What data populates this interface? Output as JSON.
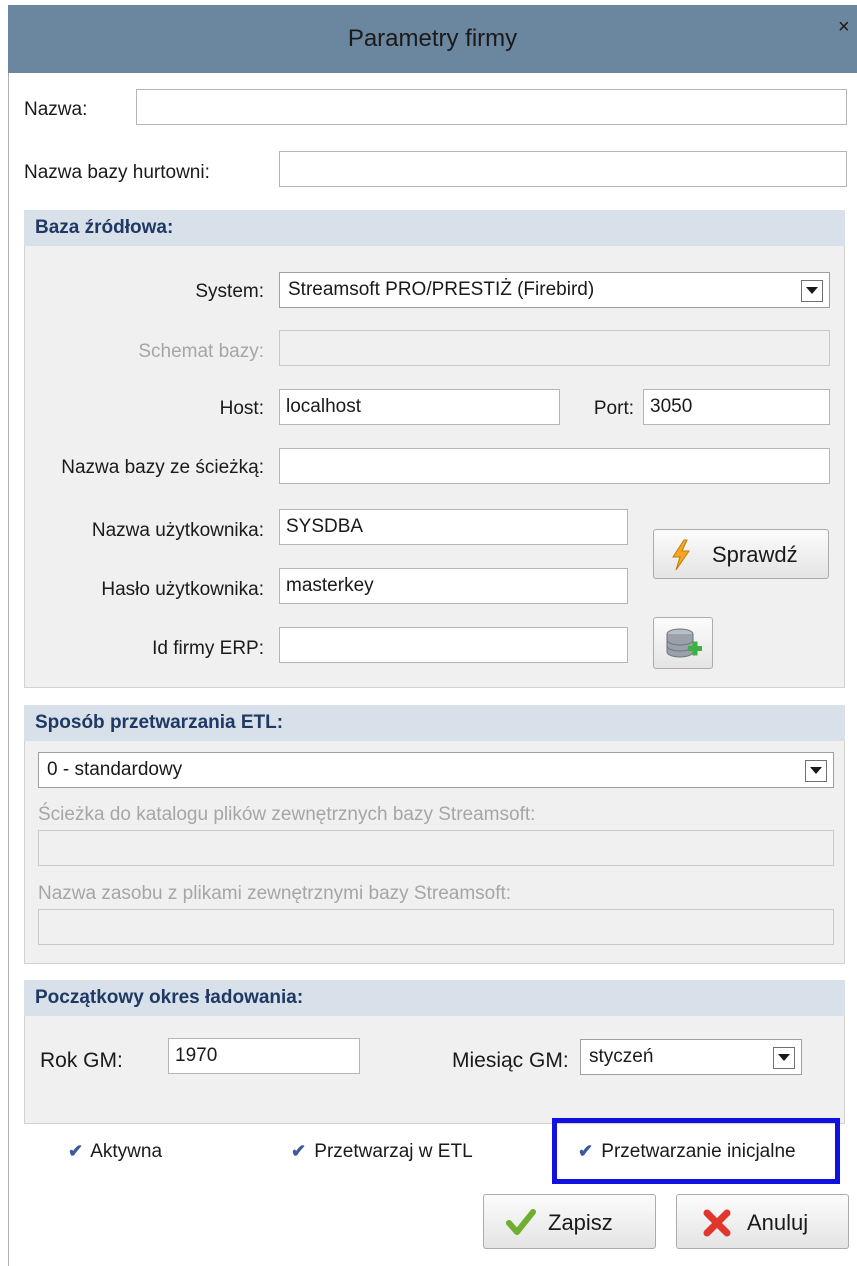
{
  "window": {
    "title": "Parametry firmy",
    "close": "×"
  },
  "top": {
    "nazwa_label": "Nazwa:",
    "nazwa_value": "",
    "hurtownia_label": "Nazwa bazy hurtowni:",
    "hurtownia_value": ""
  },
  "source": {
    "header": "Baza źródłowa:",
    "system_label": "System:",
    "system_value": "Streamsoft PRO/PRESTIŻ (Firebird)",
    "schemat_label": "Schemat bazy:",
    "schemat_value": "",
    "host_label": "Host:",
    "host_value": "localhost",
    "port_label": "Port:",
    "port_value": "3050",
    "path_label": "Nazwa bazy ze ścieżką:",
    "path_value": "",
    "user_label": "Nazwa użytkownika:",
    "user_value": "SYSDBA",
    "password_label": "Hasło użytkownika:",
    "password_value": "masterkey",
    "erp_label": "Id firmy ERP:",
    "erp_value": "",
    "check_button": "Sprawdź"
  },
  "etl": {
    "header": "Sposób przetwarzania ETL:",
    "mode_value": "0 - standardowy",
    "catalog_label": "Ścieżka do katalogu plików zewnętrznych bazy Streamsoft:",
    "catalog_value": "",
    "resource_label": "Nazwa zasobu z plikami zewnętrznymi bazy Streamsoft:",
    "resource_value": ""
  },
  "period": {
    "header": "Początkowy okres ładowania:",
    "year_label": "Rok GM:",
    "year_value": "1970",
    "month_label": "Miesiąc GM:",
    "month_value": "styczeń"
  },
  "options": {
    "active": {
      "label": "Aktywna",
      "checked": true
    },
    "etl": {
      "label": "Przetwarzaj w ETL",
      "checked": true
    },
    "initial": {
      "label": "Przetwarzanie inicjalne",
      "checked": true
    }
  },
  "buttons": {
    "save": "Zapisz",
    "cancel": "Anuluj"
  },
  "colors": {
    "titlebar": "#6b869f",
    "group_header": "#d8e1e9",
    "group_text": "#1f3864",
    "highlight": "#1010e0"
  }
}
